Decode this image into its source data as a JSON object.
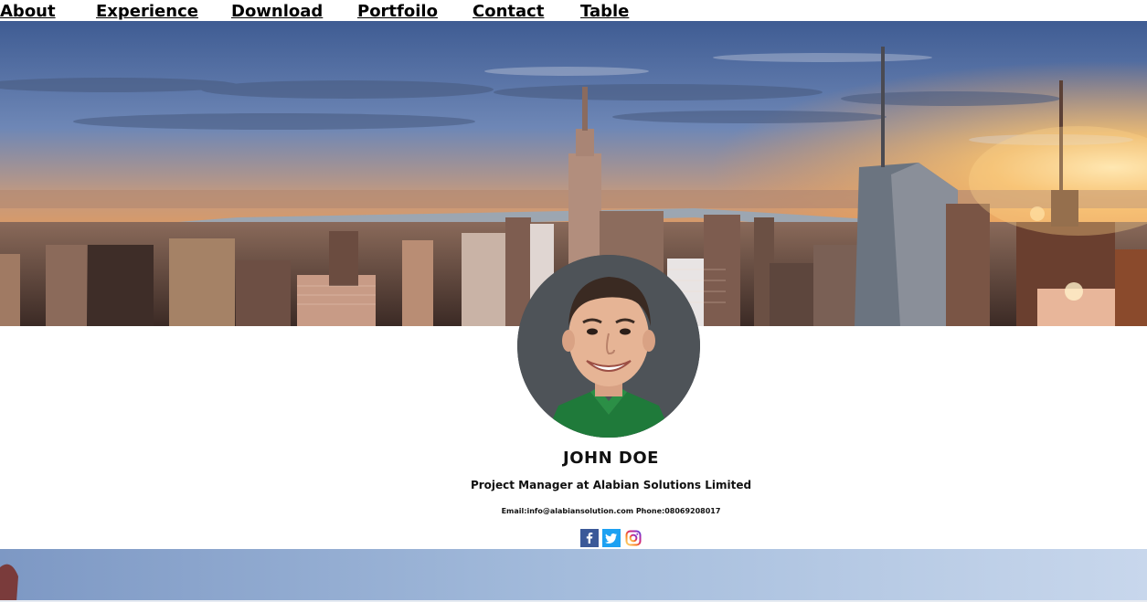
{
  "nav": {
    "items": [
      "About",
      "Experience",
      "Download",
      "Portfoilo",
      "Contact",
      "Table"
    ]
  },
  "profile": {
    "name": "JOHN DOE",
    "title": "Project Manager at Alabian Solutions Limited",
    "contact_line": "Email:info@alabiansolution.com Phone:08069208017"
  },
  "social": {
    "icons": [
      "facebook-icon",
      "twitter-icon",
      "instagram-icon"
    ]
  },
  "colors": {
    "facebook": "#3b5998",
    "twitter": "#1da1f2",
    "instagram": "#c13584"
  }
}
